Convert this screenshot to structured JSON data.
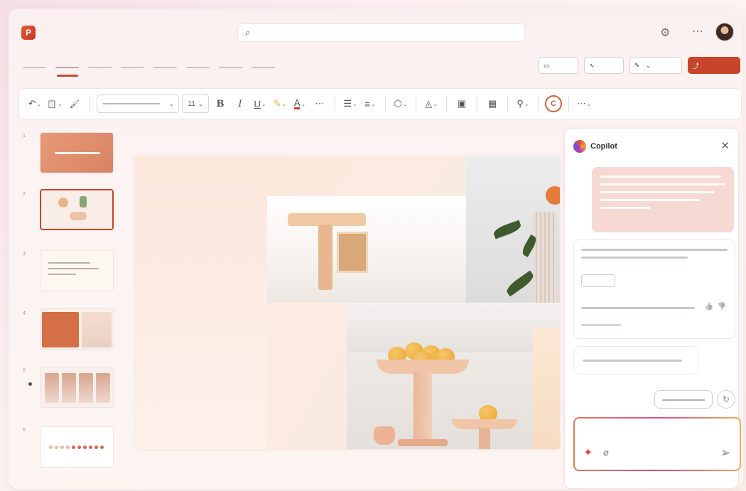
{
  "app": {
    "icon_letter": "P",
    "search_icon": "⌕",
    "search_placeholder": ""
  },
  "header": {
    "settings_icon": "⚙",
    "more_icon": "⋯"
  },
  "tabs": [
    {
      "label": ""
    },
    {
      "label": ""
    },
    {
      "label": ""
    },
    {
      "label": ""
    },
    {
      "label": ""
    },
    {
      "label": ""
    },
    {
      "label": ""
    },
    {
      "label": ""
    }
  ],
  "top_actions": {
    "comments_icon": "▭",
    "catchup_icon": "∿",
    "editing_icon": "✎",
    "share_icon": "⤴",
    "comments_label": "",
    "catchup_label": "",
    "editing_label": "",
    "share_label": ""
  },
  "ribbon": {
    "undo": "↶",
    "paste": "📋",
    "format_painter": "🖌",
    "font_size": "11",
    "bold": "B",
    "italic": "I",
    "underline": "U",
    "highlight": "✎",
    "font_color": "A",
    "more": "⋯",
    "bullets": "☰",
    "align": "≡",
    "shapes": "⬡",
    "fill": "◬",
    "arrange": "▣",
    "designer": "▦",
    "tools": "⚲",
    "copilot": "C",
    "overflow": "⋯"
  },
  "slides": [
    {
      "num": "1"
    },
    {
      "num": "2"
    },
    {
      "num": "3"
    },
    {
      "num": "4"
    },
    {
      "num": "5"
    },
    {
      "num": "6"
    }
  ],
  "copilot": {
    "title": "Copilot",
    "close_icon": "✕",
    "thumb_up": "👍",
    "thumb_down": "👎",
    "refresh_icon": "↻",
    "sparkle_icon": "✦",
    "attach_icon": "⌀",
    "send_icon": "➢",
    "compose_placeholder": ""
  },
  "colors": {
    "accent": "#c8452a",
    "copilot_user_bubble": "#f6d9d3"
  }
}
